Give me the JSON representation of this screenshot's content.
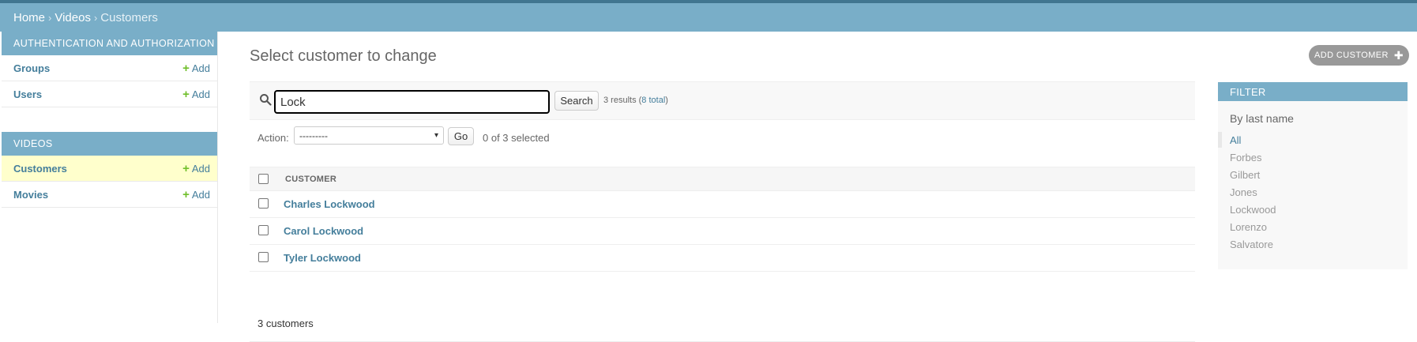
{
  "breadcrumb": {
    "home": "Home",
    "sep1": "›",
    "videos": "Videos",
    "sep2": "›",
    "current": "Customers"
  },
  "sidebar": {
    "modules": [
      {
        "caption": "AUTHENTICATION AND AUTHORIZATION",
        "rows": [
          {
            "label": "Groups",
            "add": "Add"
          },
          {
            "label": "Users",
            "add": "Add"
          }
        ]
      },
      {
        "caption": "VIDEOS",
        "rows": [
          {
            "label": "Customers",
            "add": "Add",
            "selected": true
          },
          {
            "label": "Movies",
            "add": "Add"
          }
        ]
      }
    ]
  },
  "main": {
    "title": "Select customer to change",
    "add_button": "ADD CUSTOMER",
    "search": {
      "value": "Lock",
      "button": "Search",
      "results_prefix": "3 results (",
      "total_link": "8 total",
      "results_suffix": ")"
    },
    "actions": {
      "label": "Action:",
      "select_value": "---------",
      "go": "Go",
      "selected_count": "0 of 3 selected"
    },
    "table": {
      "column": "CUSTOMER",
      "rows": [
        "Charles Lockwood",
        "Carol Lockwood",
        "Tyler Lockwood"
      ]
    },
    "paginator": "3 customers"
  },
  "filter": {
    "title": "FILTER",
    "subtitle": "By last name",
    "items": [
      "All",
      "Forbes",
      "Gilbert",
      "Jones",
      "Lockwood",
      "Lorenzo",
      "Salvatore"
    ],
    "selected": "All"
  },
  "colors": {
    "header": "#79aec8",
    "link": "#447e9b",
    "add_green": "#70bf2b",
    "selected_row": "#ffffcc"
  }
}
